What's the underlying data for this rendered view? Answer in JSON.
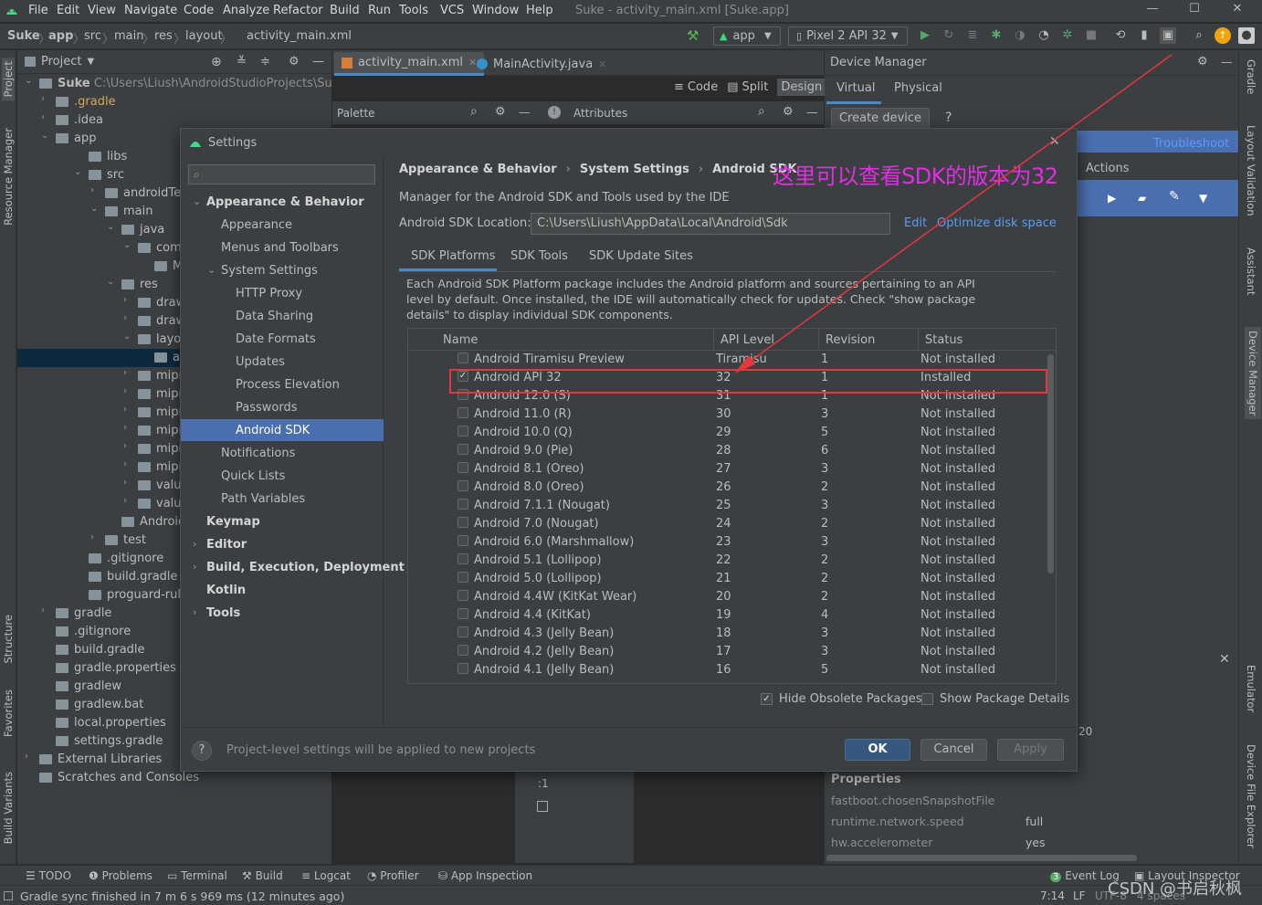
{
  "window": {
    "title": "Suke - activity_main.xml [Suke.app]",
    "menu": [
      "File",
      "Edit",
      "View",
      "Navigate",
      "Code",
      "Analyze",
      "Refactor",
      "Build",
      "Run",
      "Tools",
      "VCS",
      "Window",
      "Help"
    ]
  },
  "breadcrumb": [
    "Suke",
    "app",
    "src",
    "main",
    "res",
    "layout",
    "activity_main.xml"
  ],
  "toolbar": {
    "run_config": "app",
    "device": "Pixel 2 API 32"
  },
  "project_panel": {
    "title": "Project",
    "root_name": "Suke",
    "root_path": "C:\\Users\\Liush\\AndroidStudioProjects\\Suke",
    "items": [
      ".gradle",
      ".idea",
      "app",
      "libs",
      "src",
      "androidTest",
      "main",
      "java",
      "com.exa",
      "Main",
      "res",
      "drawab",
      "drawab",
      "layout",
      "activi",
      "mipmap",
      "mipmap",
      "mipmap",
      "mipmap",
      "mipmap",
      "mipmap",
      "values",
      "values-",
      "AndroidMa",
      "test",
      ".gitignore",
      "build.gradle",
      "proguard-rules.p",
      "gradle",
      ".gitignore",
      "build.gradle",
      "gradle.properties",
      "gradlew",
      "gradlew.bat",
      "local.properties",
      "settings.gradle",
      "External Libraries",
      "Scratches and Consoles"
    ]
  },
  "editor": {
    "tabs": [
      "activity_main.xml",
      "MainActivity.java"
    ],
    "views": [
      "Code",
      "Split",
      "Design"
    ],
    "palette_label": "Palette",
    "attributes_label": "Attributes"
  },
  "device_manager": {
    "title": "Device Manager",
    "tabs": [
      "Virtual",
      "Physical"
    ],
    "create_device": "Create device",
    "help": "?",
    "troubleshoot": "Troubleshoot",
    "actions": "Actions",
    "properties_title": "Properties",
    "properties": [
      {
        "key": "fastboot.chosenSnapshotFile",
        "value": ""
      },
      {
        "key": "runtime.network.speed",
        "value": "full"
      },
      {
        "key": "hw.accelerometer",
        "value": "yes"
      }
    ],
    "partial_text": "20"
  },
  "right_strip": [
    "Gradle",
    "Layout Validation",
    "Assistant",
    "Device Manager",
    "Emulator",
    "Device File Explorer"
  ],
  "left_strip": [
    "Project",
    "Resource Manager",
    "Structure",
    "Favorites",
    "Build Variants"
  ],
  "settings": {
    "title": "Settings",
    "search_placeholder": "",
    "nav": [
      {
        "label": "Appearance & Behavior",
        "level": 0,
        "bold": true,
        "arrow": "down"
      },
      {
        "label": "Appearance",
        "level": 1
      },
      {
        "label": "Menus and Toolbars",
        "level": 1
      },
      {
        "label": "System Settings",
        "level": 1,
        "arrow": "down"
      },
      {
        "label": "HTTP Proxy",
        "level": 2
      },
      {
        "label": "Data Sharing",
        "level": 2
      },
      {
        "label": "Date Formats",
        "level": 2
      },
      {
        "label": "Updates",
        "level": 2
      },
      {
        "label": "Process Elevation",
        "level": 2
      },
      {
        "label": "Passwords",
        "level": 2
      },
      {
        "label": "Android SDK",
        "level": 2,
        "selected": true
      },
      {
        "label": "Notifications",
        "level": 1
      },
      {
        "label": "Quick Lists",
        "level": 1
      },
      {
        "label": "Path Variables",
        "level": 1
      },
      {
        "label": "Keymap",
        "level": 0,
        "bold": true
      },
      {
        "label": "Editor",
        "level": 0,
        "bold": true,
        "arrow": "right"
      },
      {
        "label": "Build, Execution, Deployment",
        "level": 0,
        "bold": true,
        "arrow": "right"
      },
      {
        "label": "Kotlin",
        "level": 0,
        "bold": true
      },
      {
        "label": "Tools",
        "level": 0,
        "bold": true,
        "arrow": "right"
      }
    ],
    "path": [
      "Appearance & Behavior",
      "System Settings",
      "Android SDK"
    ],
    "annotation": "这里可以查看SDK的版本为32",
    "description": "Manager for the Android SDK and Tools used by the IDE",
    "location_label": "Android SDK Location:",
    "location_value": "C:\\Users\\Liush\\AppData\\Local\\Android\\Sdk",
    "edit_link": "Edit",
    "optimize_link": "Optimize disk space",
    "sdk_tabs": [
      "SDK Platforms",
      "SDK Tools",
      "SDK Update Sites"
    ],
    "info": [
      "Each Android SDK Platform package includes the Android platform and sources pertaining to an API",
      "level by default. Once installed, the IDE will automatically check for updates. Check \"show package",
      "details\" to display individual SDK components."
    ],
    "columns": [
      "Name",
      "API Level",
      "Revision",
      "Status"
    ],
    "rows": [
      {
        "name": "Android Tiramisu Preview",
        "api": "Tiramisu",
        "rev": "1",
        "status": "Not installed",
        "checked": false
      },
      {
        "name": "Android API 32",
        "api": "32",
        "rev": "1",
        "status": "Installed",
        "checked": true
      },
      {
        "name": "Android 12.0 (S)",
        "api": "31",
        "rev": "1",
        "status": "Not installed",
        "checked": false
      },
      {
        "name": "Android 11.0 (R)",
        "api": "30",
        "rev": "3",
        "status": "Not installed",
        "checked": false
      },
      {
        "name": "Android 10.0 (Q)",
        "api": "29",
        "rev": "5",
        "status": "Not installed",
        "checked": false
      },
      {
        "name": "Android 9.0 (Pie)",
        "api": "28",
        "rev": "6",
        "status": "Not installed",
        "checked": false
      },
      {
        "name": "Android 8.1 (Oreo)",
        "api": "27",
        "rev": "3",
        "status": "Not installed",
        "checked": false
      },
      {
        "name": "Android 8.0 (Oreo)",
        "api": "26",
        "rev": "2",
        "status": "Not installed",
        "checked": false
      },
      {
        "name": "Android 7.1.1 (Nougat)",
        "api": "25",
        "rev": "3",
        "status": "Not installed",
        "checked": false
      },
      {
        "name": "Android 7.0 (Nougat)",
        "api": "24",
        "rev": "2",
        "status": "Not installed",
        "checked": false
      },
      {
        "name": "Android 6.0 (Marshmallow)",
        "api": "23",
        "rev": "3",
        "status": "Not installed",
        "checked": false
      },
      {
        "name": "Android 5.1 (Lollipop)",
        "api": "22",
        "rev": "2",
        "status": "Not installed",
        "checked": false
      },
      {
        "name": "Android 5.0 (Lollipop)",
        "api": "21",
        "rev": "2",
        "status": "Not installed",
        "checked": false
      },
      {
        "name": "Android 4.4W (KitKat Wear)",
        "api": "20",
        "rev": "2",
        "status": "Not installed",
        "checked": false
      },
      {
        "name": "Android 4.4 (KitKat)",
        "api": "19",
        "rev": "4",
        "status": "Not installed",
        "checked": false
      },
      {
        "name": "Android 4.3 (Jelly Bean)",
        "api": "18",
        "rev": "3",
        "status": "Not installed",
        "checked": false
      },
      {
        "name": "Android 4.2 (Jelly Bean)",
        "api": "17",
        "rev": "3",
        "status": "Not installed",
        "checked": false
      },
      {
        "name": "Android 4.1 (Jelly Bean)",
        "api": "16",
        "rev": "5",
        "status": "Not installed",
        "checked": false
      }
    ],
    "hide_obsolete": "Hide Obsolete Packages",
    "show_details": "Show Package Details",
    "footer_note": "Project-level settings will be applied to new projects",
    "ok": "OK",
    "cancel": "Cancel",
    "apply": "Apply"
  },
  "bottom_tools": [
    "TODO",
    "Problems",
    "Terminal",
    "Build",
    "Logcat",
    "Profiler",
    "App Inspection",
    "Event Log",
    "Layout Inspector"
  ],
  "event_count": "3",
  "status": {
    "message": "Gradle sync finished in 7 m 6 s 969 ms (12 minutes ago)",
    "position": "7:14",
    "line_sep": "LF",
    "encoding": "UTF-8",
    "indent": "4 spaces"
  },
  "watermark": "CSDN @书启秋枫",
  "colors": {
    "accent": "#4a88c7",
    "selection": "#4b6eaf",
    "highlight": "#e0383b",
    "annotation": "#e22ee2",
    "link": "#589df6"
  }
}
